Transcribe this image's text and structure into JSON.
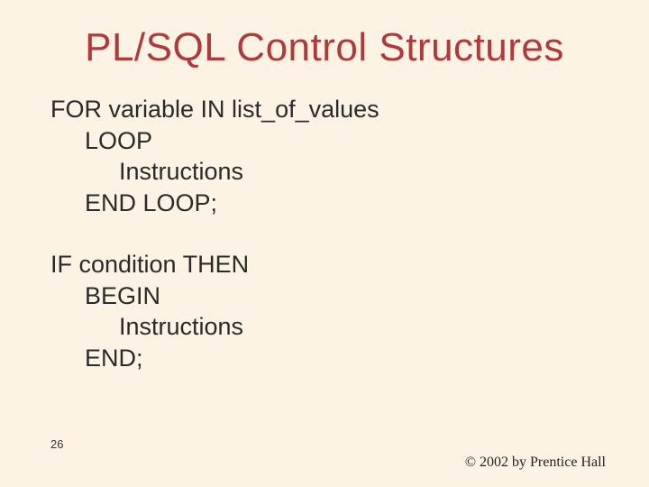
{
  "title": "PL/SQL Control Structures",
  "for_block": {
    "l1": "FOR variable IN list_of_values",
    "l2": "LOOP",
    "l3": "Instructions",
    "l4": "END LOOP;"
  },
  "if_block": {
    "l1": "IF condition THEN",
    "l2": "BEGIN",
    "l3": "Instructions",
    "l4": "END;"
  },
  "page_number": "26",
  "copyright": "© 2002 by Prentice Hall"
}
